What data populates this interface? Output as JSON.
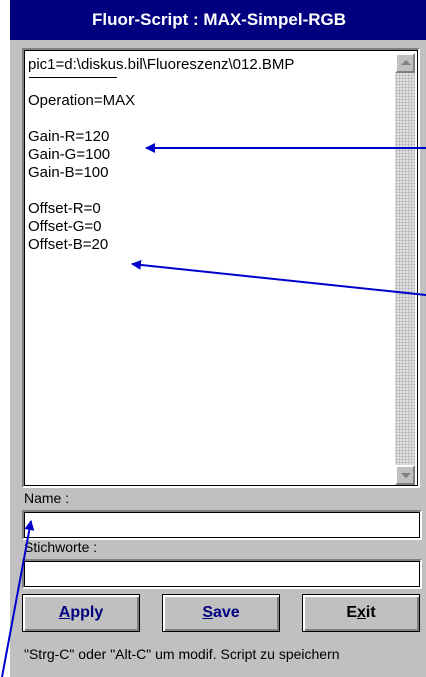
{
  "window": {
    "title": "Fluor-Script : MAX-Simpel-RGB"
  },
  "script": {
    "header_line": "pic1=d:\\diskus.bil\\Fluoreszenz\\012.BMP",
    "lines": [
      "Operation=MAX",
      "",
      "Gain-R=120",
      "Gain-G=100",
      "Gain-B=100",
      "",
      "Offset-R=0",
      "Offset-G=0",
      "Offset-B=20"
    ]
  },
  "name_field": {
    "label": "Name :",
    "value": ""
  },
  "keywords_field": {
    "label": "Stichworte :",
    "value": ""
  },
  "buttons": {
    "apply": {
      "hotkey": "A",
      "rest": "pply"
    },
    "save": {
      "hotkey": "S",
      "rest": "ave"
    },
    "exit": {
      "first": "E",
      "hotkey": "x",
      "rest": "it"
    }
  },
  "hint": "\"Strg-C\" oder \"Alt-C\" um modif. Script zu speichern",
  "colors": {
    "titlebar": "#000080",
    "window_bg": "#c0c0c0",
    "annotation_arrow": "#0000cc"
  },
  "icons": [
    "scroll-up-arrow-icon",
    "scroll-down-arrow-icon",
    "annotation-arrow-icon"
  ]
}
